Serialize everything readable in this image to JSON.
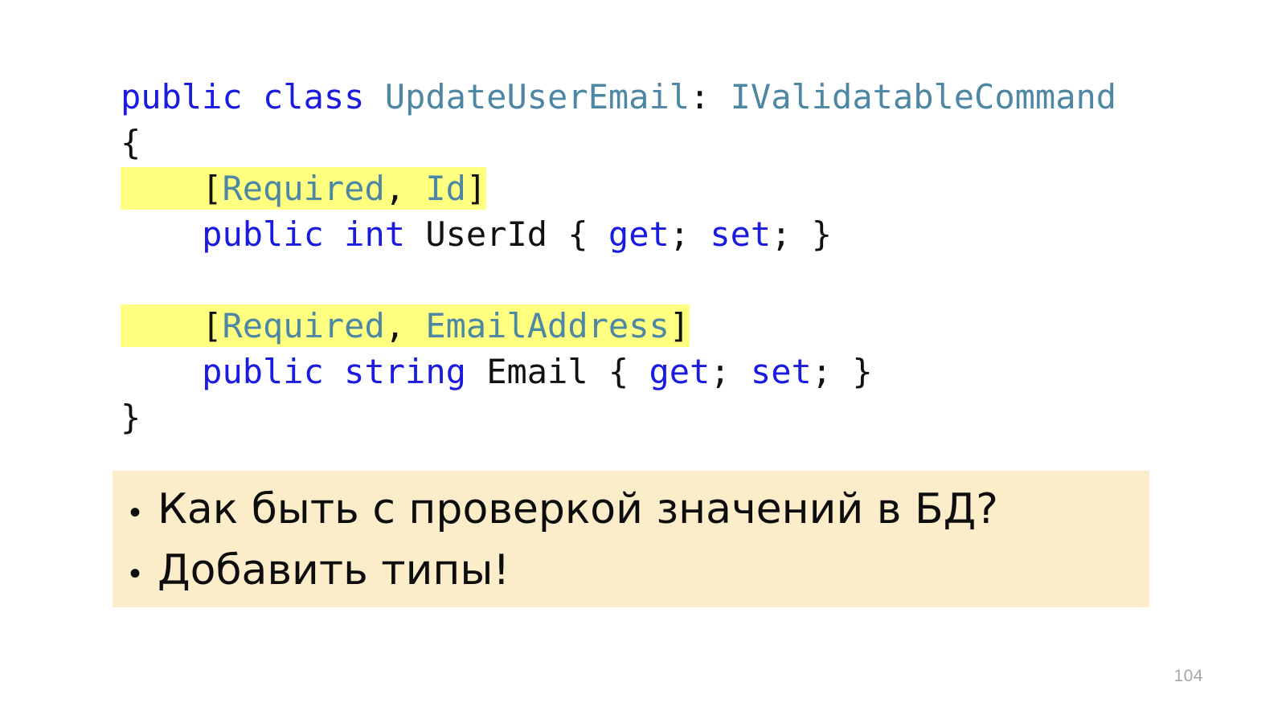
{
  "slide": {
    "page_number": "104",
    "background_color": "#ffffff"
  },
  "palette": {
    "keyword_blue": "#1a1ae0",
    "type_teal": "#4d87a4",
    "punctuation_black": "#111111",
    "highlight_yellow": "#ffff80",
    "callout_beige": "#fbecca",
    "page_number_gray": "#a6a6a6"
  },
  "code": {
    "language": "csharp",
    "plain_text": "public class UpdateUserEmail: IValidatableCommand\n{\n    [Required, Id]\n    public int UserId { get; set; }\n\n    [Required, EmailAddress]\n    public string Email { get; set; }\n}",
    "lines": [
      {
        "id": "line-class-declaration",
        "highlighted": false,
        "tokens": [
          {
            "text": "public",
            "kind": "kw"
          },
          {
            "text": " ",
            "kind": "pun"
          },
          {
            "text": "class",
            "kind": "kw"
          },
          {
            "text": " ",
            "kind": "pun"
          },
          {
            "text": "UpdateUserEmail",
            "kind": "type"
          },
          {
            "text": ": ",
            "kind": "pun"
          },
          {
            "text": "IValidatableCommand",
            "kind": "type"
          }
        ]
      },
      {
        "id": "line-open-brace",
        "highlighted": false,
        "tokens": [
          {
            "text": "{",
            "kind": "pun"
          }
        ]
      },
      {
        "id": "line-attributes-userid",
        "highlighted": true,
        "indent": "    ",
        "tokens": [
          {
            "text": "[",
            "kind": "pun"
          },
          {
            "text": "Required",
            "kind": "type"
          },
          {
            "text": ", ",
            "kind": "pun"
          },
          {
            "text": "Id",
            "kind": "type"
          },
          {
            "text": "]",
            "kind": "pun"
          }
        ]
      },
      {
        "id": "line-property-userid",
        "highlighted": false,
        "indent": "    ",
        "tokens": [
          {
            "text": "public",
            "kind": "kw"
          },
          {
            "text": " ",
            "kind": "pun"
          },
          {
            "text": "int",
            "kind": "kw"
          },
          {
            "text": " ",
            "kind": "pun"
          },
          {
            "text": "UserId",
            "kind": "id"
          },
          {
            "text": " { ",
            "kind": "pun"
          },
          {
            "text": "get",
            "kind": "kw"
          },
          {
            "text": "; ",
            "kind": "pun"
          },
          {
            "text": "set",
            "kind": "kw"
          },
          {
            "text": "; }",
            "kind": "pun"
          }
        ]
      },
      {
        "id": "line-blank",
        "highlighted": false,
        "tokens": []
      },
      {
        "id": "line-attributes-email",
        "highlighted": true,
        "indent": "    ",
        "tokens": [
          {
            "text": "[",
            "kind": "pun"
          },
          {
            "text": "Required",
            "kind": "type"
          },
          {
            "text": ", ",
            "kind": "pun"
          },
          {
            "text": "EmailAddress",
            "kind": "type"
          },
          {
            "text": "]",
            "kind": "pun"
          }
        ]
      },
      {
        "id": "line-property-email",
        "highlighted": false,
        "indent": "    ",
        "tokens": [
          {
            "text": "public",
            "kind": "kw"
          },
          {
            "text": " ",
            "kind": "pun"
          },
          {
            "text": "string",
            "kind": "kw"
          },
          {
            "text": " ",
            "kind": "pun"
          },
          {
            "text": "Email",
            "kind": "id"
          },
          {
            "text": " { ",
            "kind": "pun"
          },
          {
            "text": "get",
            "kind": "kw"
          },
          {
            "text": "; ",
            "kind": "pun"
          },
          {
            "text": "set",
            "kind": "kw"
          },
          {
            "text": "; }",
            "kind": "pun"
          }
        ]
      },
      {
        "id": "line-close-brace",
        "highlighted": false,
        "tokens": [
          {
            "text": "}",
            "kind": "pun"
          }
        ]
      }
    ]
  },
  "callout": {
    "bullet_glyph": "•",
    "items": [
      {
        "id": "callout-item-1",
        "text": "Как быть с проверкой значений в БД?"
      },
      {
        "id": "callout-item-2",
        "text": "Добавить типы!"
      }
    ]
  }
}
